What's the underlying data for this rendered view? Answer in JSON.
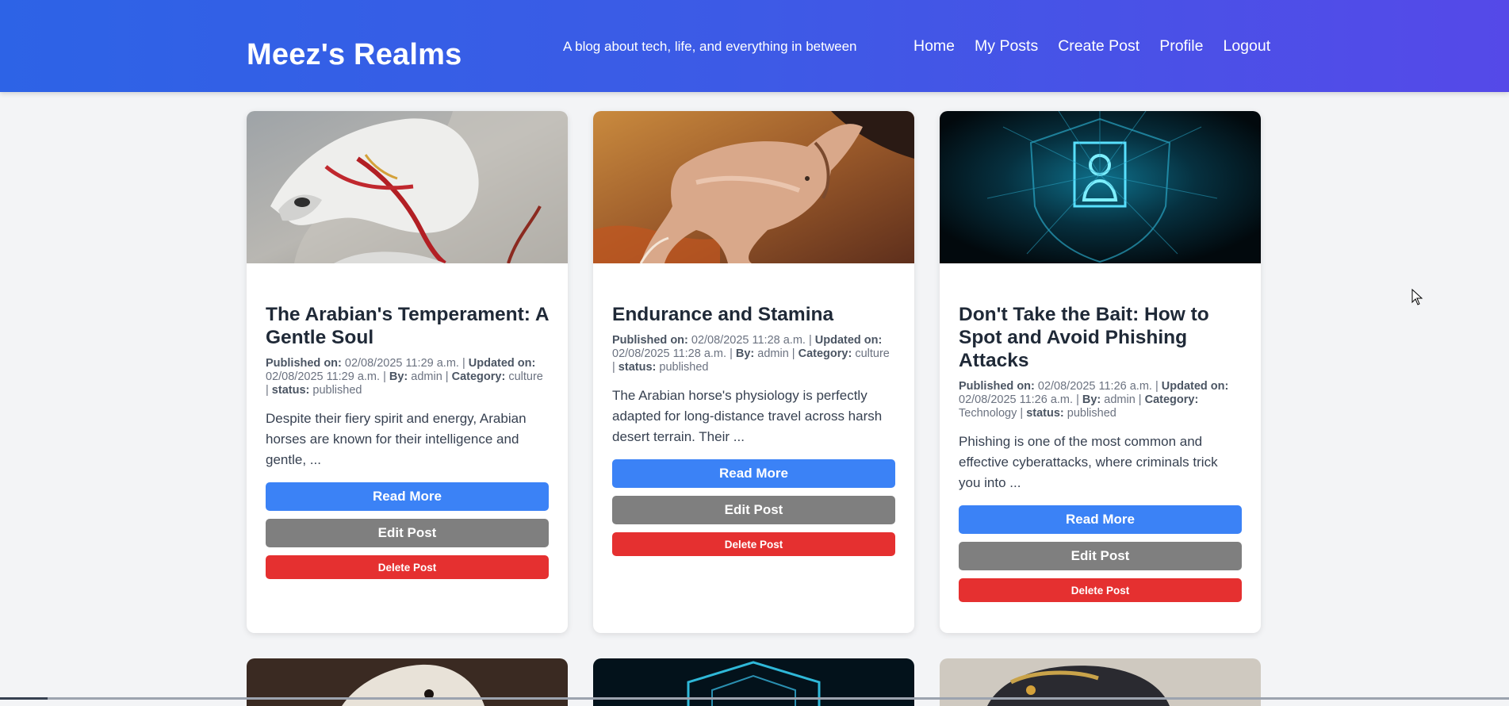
{
  "header": {
    "brand": "Meez's Realms",
    "tagline": "A blog about tech, life, and everything in between",
    "nav": [
      "Home",
      "My Posts",
      "Create Post",
      "Profile",
      "Logout"
    ]
  },
  "labels": {
    "published_on": "Published on:",
    "updated_on": "Updated on:",
    "by": "By:",
    "category": "Category:",
    "status": "status:",
    "read_more": "Read More",
    "edit_post": "Edit Post",
    "delete_post": "Delete Post"
  },
  "posts": [
    {
      "title": "The Arabian's Temperament: A Gentle Soul",
      "published": "02/08/2025 11:29 a.m.",
      "updated": "02/08/2025 11:29 a.m.",
      "author": "admin",
      "category": "culture",
      "status": "published",
      "excerpt": "Despite their fiery spirit and energy, Arabian horses are known for their intelligence and gentle, ...",
      "image": "white-horse-painting"
    },
    {
      "title": "Endurance and Stamina",
      "published": "02/08/2025 11:28 a.m.",
      "updated": "02/08/2025 11:28 a.m.",
      "author": "admin",
      "category": "culture",
      "status": "published",
      "excerpt": "The Arabian horse's physiology is perfectly adapted for long-distance travel across harsh desert terrain. Their ...",
      "image": "galloping-horse-painting"
    },
    {
      "title": "Don't Take the Bait: How to Spot and Avoid Phishing Attacks",
      "published": "02/08/2025 11:26 a.m.",
      "updated": "02/08/2025 11:26 a.m.",
      "author": "admin",
      "category": "Technology",
      "status": "published",
      "excerpt": "Phishing is one of the most common and effective cyberattacks, where criminals trick you into ...",
      "image": "cyber-user-shield"
    }
  ],
  "colors": {
    "header_start": "#2d63e6",
    "header_end": "#5549e8",
    "read_more": "#3b82f6",
    "edit_post": "#7f7f7f",
    "delete_post": "#e53030"
  }
}
